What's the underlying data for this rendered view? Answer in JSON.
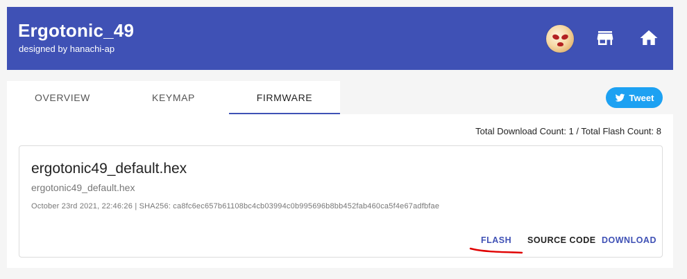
{
  "header": {
    "title": "Ergotonic_49",
    "subtitle": "designed by hanachi-ap",
    "icons": [
      "avatar",
      "store-icon",
      "home-icon"
    ],
    "color": "#3f51b5"
  },
  "tabs": [
    {
      "label": "OVERVIEW",
      "active": false
    },
    {
      "label": "KEYMAP",
      "active": false
    },
    {
      "label": "FIRMWARE",
      "active": true
    }
  ],
  "tweet": {
    "label": "Tweet",
    "color": "#1da1f2"
  },
  "stats": {
    "text": "Total Download Count: 1 / Total Flash Count: 8"
  },
  "firmware": {
    "name": "ergotonic49_default.hex",
    "filename": "ergotonic49_default.hex",
    "meta": "October 23rd 2021, 22:46:26 | SHA256: ca8fc6ec657b61108bc4cb03994c0b995696b8bb452fab460ca5f4e67adfbfae",
    "actions": {
      "flash": "FLASH",
      "source": "SOURCE CODE",
      "download": "DOWNLOAD"
    }
  },
  "annotation": {
    "color": "#e00000"
  }
}
